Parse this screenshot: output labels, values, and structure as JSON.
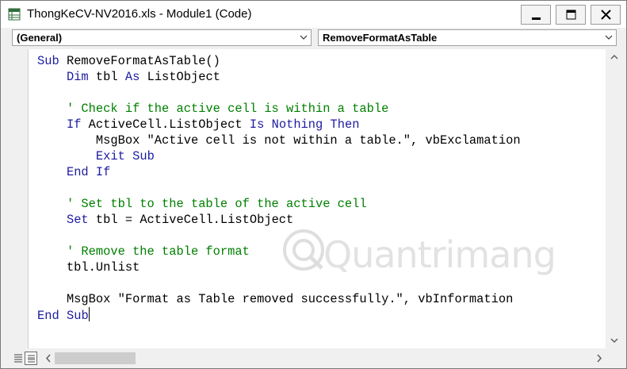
{
  "window": {
    "title": "ThongKeCV-NV2016.xls - Module1 (Code)",
    "controls": [
      "minimize-icon",
      "maximize-icon",
      "close-icon"
    ]
  },
  "dropdowns": {
    "object": "(General)",
    "procedure": "RemoveFormatAsTable"
  },
  "code": {
    "lines": [
      [
        {
          "t": "Sub",
          "c": "kw"
        },
        {
          "t": " RemoveFormatAsTable()"
        }
      ],
      [
        {
          "t": "    "
        },
        {
          "t": "Dim",
          "c": "kw"
        },
        {
          "t": " tbl "
        },
        {
          "t": "As",
          "c": "kw"
        },
        {
          "t": " ListObject"
        }
      ],
      [
        {
          "t": ""
        }
      ],
      [
        {
          "t": "    "
        },
        {
          "t": "' Check if the active cell is within a table",
          "c": "cm"
        }
      ],
      [
        {
          "t": "    "
        },
        {
          "t": "If",
          "c": "kw"
        },
        {
          "t": " ActiveCell.ListObject "
        },
        {
          "t": "Is",
          "c": "kw"
        },
        {
          "t": " "
        },
        {
          "t": "Nothing",
          "c": "kw"
        },
        {
          "t": " "
        },
        {
          "t": "Then",
          "c": "kw"
        }
      ],
      [
        {
          "t": "        MsgBox \"Active cell is not within a table.\", vbExclamation"
        }
      ],
      [
        {
          "t": "        "
        },
        {
          "t": "Exit",
          "c": "kw"
        },
        {
          "t": " "
        },
        {
          "t": "Sub",
          "c": "kw"
        }
      ],
      [
        {
          "t": "    "
        },
        {
          "t": "End",
          "c": "kw"
        },
        {
          "t": " "
        },
        {
          "t": "If",
          "c": "kw"
        }
      ],
      [
        {
          "t": ""
        }
      ],
      [
        {
          "t": "    "
        },
        {
          "t": "' Set tbl to the table of the active cell",
          "c": "cm"
        }
      ],
      [
        {
          "t": "    "
        },
        {
          "t": "Set",
          "c": "kw"
        },
        {
          "t": " tbl = ActiveCell.ListObject"
        }
      ],
      [
        {
          "t": ""
        }
      ],
      [
        {
          "t": "    "
        },
        {
          "t": "' Remove the table format",
          "c": "cm"
        }
      ],
      [
        {
          "t": "    tbl.Unlist"
        }
      ],
      [
        {
          "t": ""
        }
      ],
      [
        {
          "t": "    MsgBox \"Format as Table removed successfully.\", vbInformation"
        }
      ],
      [
        {
          "t": "End",
          "c": "kw"
        },
        {
          "t": " "
        },
        {
          "t": "Sub",
          "c": "kw"
        },
        {
          "caret": true
        }
      ]
    ]
  },
  "watermark": {
    "text": "Quantrimang"
  },
  "colors": {
    "keyword": "#1c1ca0",
    "comment": "#008000",
    "text": "#000000",
    "editor_bg": "#ffffff",
    "chrome_bg": "#f0f0f0"
  }
}
